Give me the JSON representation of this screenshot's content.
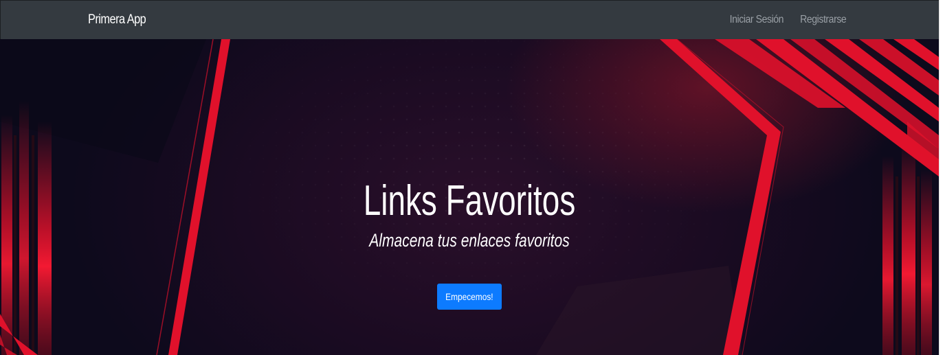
{
  "navbar": {
    "brand": "Primera App",
    "links": [
      {
        "label": "Iniciar Sesión"
      },
      {
        "label": "Registrarse"
      }
    ],
    "background": "#343a40"
  },
  "hero": {
    "title": "Links Favoritos",
    "subtitle": "Almacena tus enlaces favoritos",
    "cta_label": "Empecemos!",
    "cta_color": "#0d7bff",
    "accent_color": "#e0112b"
  }
}
